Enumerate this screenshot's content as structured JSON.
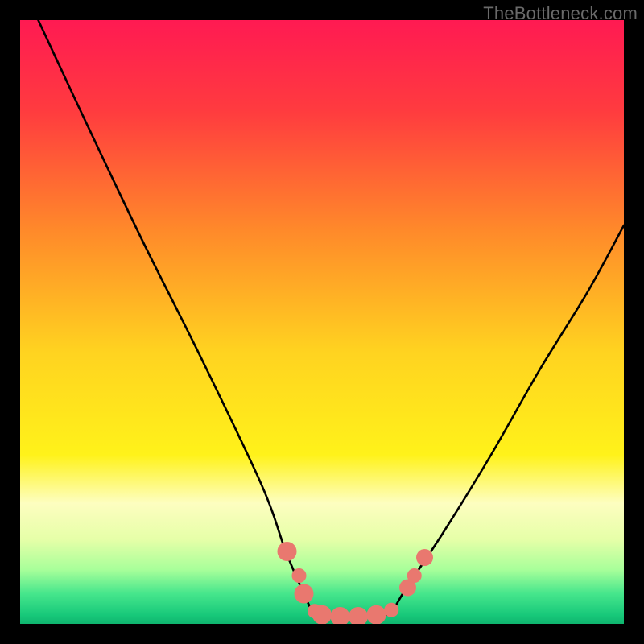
{
  "watermark": "TheBottleneck.com",
  "chart_data": {
    "type": "line",
    "title": "",
    "xlabel": "",
    "ylabel": "",
    "xlim": [
      0,
      100
    ],
    "ylim": [
      0,
      100
    ],
    "grid": false,
    "legend": false,
    "series": [
      {
        "name": "left-curve",
        "x": [
          3,
          10,
          20,
          30,
          40,
          44,
          47,
          48.5
        ],
        "y": [
          100,
          85,
          64,
          44,
          23,
          12,
          5,
          2
        ]
      },
      {
        "name": "flat-bottom",
        "x": [
          48.5,
          50,
          52,
          54,
          56,
          58,
          60,
          61.5
        ],
        "y": [
          2,
          1.5,
          1.3,
          1.2,
          1.2,
          1.3,
          1.5,
          2
        ]
      },
      {
        "name": "right-curve",
        "x": [
          61.5,
          64,
          70,
          78,
          86,
          94,
          100
        ],
        "y": [
          2,
          6,
          15,
          28,
          42,
          55,
          66
        ]
      }
    ],
    "markers": [
      {
        "x": 44.2,
        "y": 12,
        "r": 1.6
      },
      {
        "x": 46.2,
        "y": 8,
        "r": 1.2
      },
      {
        "x": 47.0,
        "y": 5,
        "r": 1.6
      },
      {
        "x": 48.8,
        "y": 2.1,
        "r": 1.2
      },
      {
        "x": 50.0,
        "y": 1.5,
        "r": 1.6
      },
      {
        "x": 53.0,
        "y": 1.2,
        "r": 1.6
      },
      {
        "x": 56.0,
        "y": 1.2,
        "r": 1.6
      },
      {
        "x": 59.0,
        "y": 1.5,
        "r": 1.6
      },
      {
        "x": 61.5,
        "y": 2.3,
        "r": 1.2
      },
      {
        "x": 64.2,
        "y": 6,
        "r": 1.4
      },
      {
        "x": 65.3,
        "y": 8,
        "r": 1.2
      },
      {
        "x": 67.0,
        "y": 11,
        "r": 1.4
      }
    ],
    "background": {
      "type": "rainbow-gradient",
      "stops": [
        {
          "pos": 0.0,
          "color": "#ff1a52"
        },
        {
          "pos": 0.15,
          "color": "#ff3b3f"
        },
        {
          "pos": 0.35,
          "color": "#ff8a2a"
        },
        {
          "pos": 0.55,
          "color": "#ffd320"
        },
        {
          "pos": 0.72,
          "color": "#fff21a"
        },
        {
          "pos": 0.8,
          "color": "#fdfec0"
        },
        {
          "pos": 0.86,
          "color": "#e6ffa8"
        },
        {
          "pos": 0.91,
          "color": "#a8ff9a"
        },
        {
          "pos": 0.95,
          "color": "#46e68c"
        },
        {
          "pos": 0.985,
          "color": "#18c97a"
        },
        {
          "pos": 1.0,
          "color": "#0fb56f"
        }
      ]
    },
    "marker_color": "#e9786f",
    "curve_color": "#000000"
  }
}
